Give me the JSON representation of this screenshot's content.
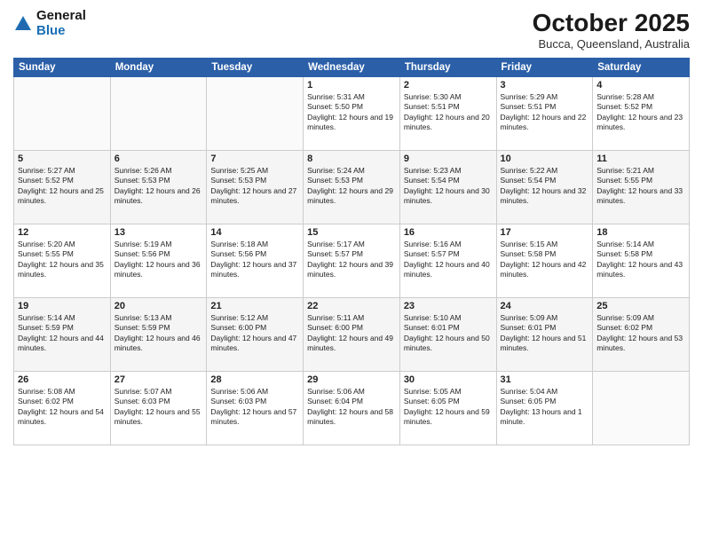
{
  "header": {
    "logo_general": "General",
    "logo_blue": "Blue",
    "month_title": "October 2025",
    "location": "Bucca, Queensland, Australia"
  },
  "days_of_week": [
    "Sunday",
    "Monday",
    "Tuesday",
    "Wednesday",
    "Thursday",
    "Friday",
    "Saturday"
  ],
  "weeks": [
    [
      {
        "day": "",
        "content": ""
      },
      {
        "day": "",
        "content": ""
      },
      {
        "day": "",
        "content": ""
      },
      {
        "day": "1",
        "content": "Sunrise: 5:31 AM\nSunset: 5:50 PM\nDaylight: 12 hours and 19 minutes."
      },
      {
        "day": "2",
        "content": "Sunrise: 5:30 AM\nSunset: 5:51 PM\nDaylight: 12 hours and 20 minutes."
      },
      {
        "day": "3",
        "content": "Sunrise: 5:29 AM\nSunset: 5:51 PM\nDaylight: 12 hours and 22 minutes."
      },
      {
        "day": "4",
        "content": "Sunrise: 5:28 AM\nSunset: 5:52 PM\nDaylight: 12 hours and 23 minutes."
      }
    ],
    [
      {
        "day": "5",
        "content": "Sunrise: 5:27 AM\nSunset: 5:52 PM\nDaylight: 12 hours and 25 minutes."
      },
      {
        "day": "6",
        "content": "Sunrise: 5:26 AM\nSunset: 5:53 PM\nDaylight: 12 hours and 26 minutes."
      },
      {
        "day": "7",
        "content": "Sunrise: 5:25 AM\nSunset: 5:53 PM\nDaylight: 12 hours and 27 minutes."
      },
      {
        "day": "8",
        "content": "Sunrise: 5:24 AM\nSunset: 5:53 PM\nDaylight: 12 hours and 29 minutes."
      },
      {
        "day": "9",
        "content": "Sunrise: 5:23 AM\nSunset: 5:54 PM\nDaylight: 12 hours and 30 minutes."
      },
      {
        "day": "10",
        "content": "Sunrise: 5:22 AM\nSunset: 5:54 PM\nDaylight: 12 hours and 32 minutes."
      },
      {
        "day": "11",
        "content": "Sunrise: 5:21 AM\nSunset: 5:55 PM\nDaylight: 12 hours and 33 minutes."
      }
    ],
    [
      {
        "day": "12",
        "content": "Sunrise: 5:20 AM\nSunset: 5:55 PM\nDaylight: 12 hours and 35 minutes."
      },
      {
        "day": "13",
        "content": "Sunrise: 5:19 AM\nSunset: 5:56 PM\nDaylight: 12 hours and 36 minutes."
      },
      {
        "day": "14",
        "content": "Sunrise: 5:18 AM\nSunset: 5:56 PM\nDaylight: 12 hours and 37 minutes."
      },
      {
        "day": "15",
        "content": "Sunrise: 5:17 AM\nSunset: 5:57 PM\nDaylight: 12 hours and 39 minutes."
      },
      {
        "day": "16",
        "content": "Sunrise: 5:16 AM\nSunset: 5:57 PM\nDaylight: 12 hours and 40 minutes."
      },
      {
        "day": "17",
        "content": "Sunrise: 5:15 AM\nSunset: 5:58 PM\nDaylight: 12 hours and 42 minutes."
      },
      {
        "day": "18",
        "content": "Sunrise: 5:14 AM\nSunset: 5:58 PM\nDaylight: 12 hours and 43 minutes."
      }
    ],
    [
      {
        "day": "19",
        "content": "Sunrise: 5:14 AM\nSunset: 5:59 PM\nDaylight: 12 hours and 44 minutes."
      },
      {
        "day": "20",
        "content": "Sunrise: 5:13 AM\nSunset: 5:59 PM\nDaylight: 12 hours and 46 minutes."
      },
      {
        "day": "21",
        "content": "Sunrise: 5:12 AM\nSunset: 6:00 PM\nDaylight: 12 hours and 47 minutes."
      },
      {
        "day": "22",
        "content": "Sunrise: 5:11 AM\nSunset: 6:00 PM\nDaylight: 12 hours and 49 minutes."
      },
      {
        "day": "23",
        "content": "Sunrise: 5:10 AM\nSunset: 6:01 PM\nDaylight: 12 hours and 50 minutes."
      },
      {
        "day": "24",
        "content": "Sunrise: 5:09 AM\nSunset: 6:01 PM\nDaylight: 12 hours and 51 minutes."
      },
      {
        "day": "25",
        "content": "Sunrise: 5:09 AM\nSunset: 6:02 PM\nDaylight: 12 hours and 53 minutes."
      }
    ],
    [
      {
        "day": "26",
        "content": "Sunrise: 5:08 AM\nSunset: 6:02 PM\nDaylight: 12 hours and 54 minutes."
      },
      {
        "day": "27",
        "content": "Sunrise: 5:07 AM\nSunset: 6:03 PM\nDaylight: 12 hours and 55 minutes."
      },
      {
        "day": "28",
        "content": "Sunrise: 5:06 AM\nSunset: 6:03 PM\nDaylight: 12 hours and 57 minutes."
      },
      {
        "day": "29",
        "content": "Sunrise: 5:06 AM\nSunset: 6:04 PM\nDaylight: 12 hours and 58 minutes."
      },
      {
        "day": "30",
        "content": "Sunrise: 5:05 AM\nSunset: 6:05 PM\nDaylight: 12 hours and 59 minutes."
      },
      {
        "day": "31",
        "content": "Sunrise: 5:04 AM\nSunset: 6:05 PM\nDaylight: 13 hours and 1 minute."
      },
      {
        "day": "",
        "content": ""
      }
    ]
  ]
}
